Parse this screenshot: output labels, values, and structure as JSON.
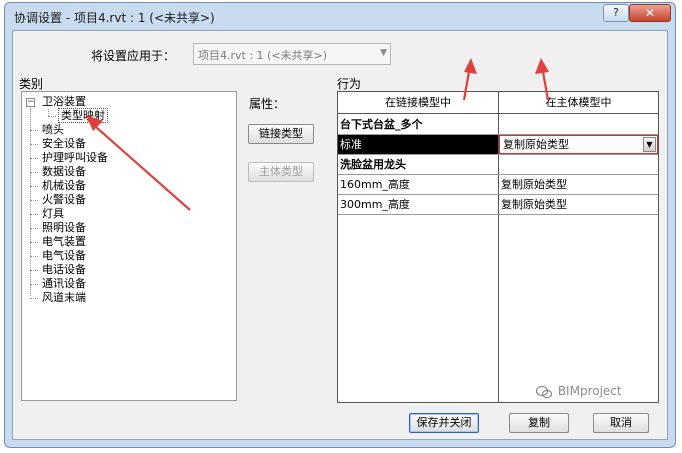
{
  "window": {
    "title": "协调设置 - 项目4.rvt : 1 (<未共享>)",
    "help_glyph": "?",
    "close_glyph": "✕"
  },
  "apply": {
    "label": "将设置应用于：",
    "value": "项目4.rvt : 1 (<未共享>)"
  },
  "category": {
    "label": "类别",
    "tree": {
      "root": "卫浴装置",
      "child": "类型映射",
      "items": [
        "喷头",
        "安全设备",
        "护理呼叫设备",
        "数据设备",
        "机械设备",
        "火警设备",
        "灯具",
        "照明设备",
        "电气装置",
        "电气设备",
        "电话设备",
        "通讯设备",
        "风道末端"
      ]
    }
  },
  "properties": {
    "label": "属性：",
    "link_type_button": "链接类型",
    "host_type_button": "主体类型"
  },
  "behavior": {
    "label": "行为",
    "columns": [
      "在链接模型中",
      "在主体模型中"
    ],
    "rows": [
      {
        "c1": "台下式台盆_多个",
        "c2": "",
        "group": true
      },
      {
        "c1": "标准",
        "c2": "复制原始类型",
        "group": false
      },
      {
        "c1": "洗脸盆用龙头",
        "c2": "",
        "group": true
      },
      {
        "c1": "160mm_高度",
        "c2": "复制原始类型",
        "group": false
      },
      {
        "c1": "300mm_高度",
        "c2": "复制原始类型",
        "group": false
      }
    ]
  },
  "footer": {
    "save_close": "保存并关闭",
    "reset": "复制",
    "cancel": "取消",
    "watermark": "BIMproject"
  },
  "colors": {
    "window_frame": "#c9dbee",
    "close_red": "#c9442b",
    "annotation_arrow": "#e0403c"
  }
}
